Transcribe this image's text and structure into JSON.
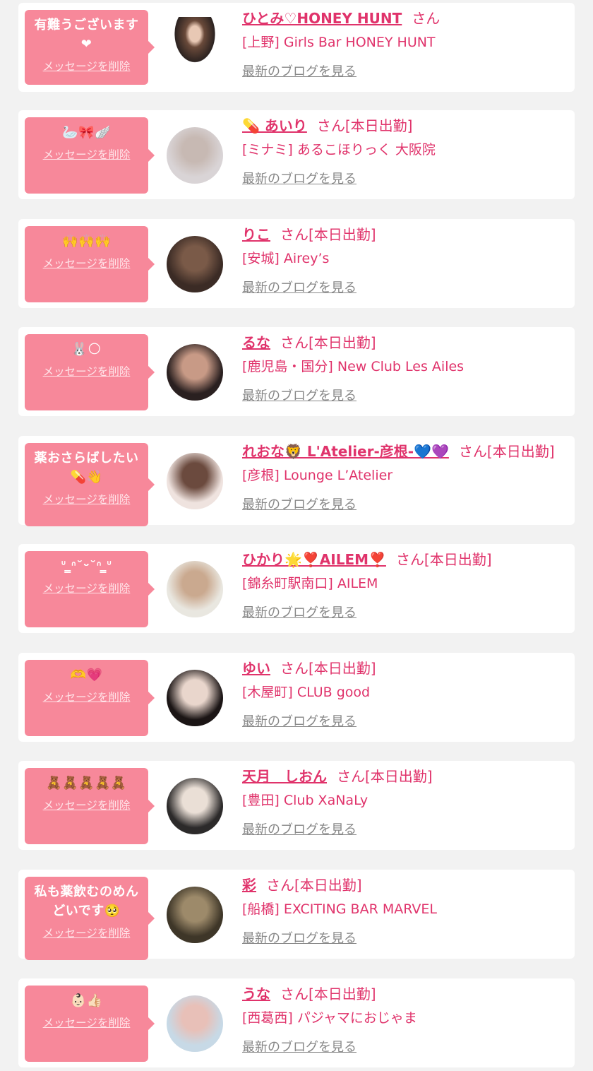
{
  "delete_label": "メッセージを削除",
  "blog_label": "最新のブログを見る",
  "colors": {
    "background": "#f2f2f2",
    "card": "#ffffff",
    "bubble": "#f7889a",
    "name": "#e0336b",
    "blog_link": "#888888"
  },
  "items": [
    {
      "message": "有難うございます❤",
      "name": "ひとみ♡HONEY HUNT",
      "suffix": "さん",
      "shop": "[上野] Girls Bar HONEY HUNT",
      "avatar": "avatar-photo"
    },
    {
      "message": "🦢🎀🪽",
      "name": "💊 あいり",
      "suffix": "さん[本日出勤]",
      "shop": "[ミナミ] あるこほりっく 大阪院",
      "avatar": "avatar-photo"
    },
    {
      "message": "🙌🙌🙌",
      "name": "りこ",
      "suffix": "さん[本日出勤]",
      "shop": "[安城] Airey’s",
      "avatar": "avatar-photo"
    },
    {
      "message": "🐰🌕",
      "name": "るな",
      "suffix": "さん[本日出勤]",
      "shop": "[鹿児島・国分] New Club Les Ailes",
      "avatar": "avatar-photo"
    },
    {
      "message": "薬おさらばしたい💊👋",
      "name": "れおな🦁 L'Atelier-彦根-💙💜",
      "suffix": "さん[本日出勤]",
      "shop": "[彦根] Lounge L’Atelier",
      "avatar": "avatar-photo"
    },
    {
      "message": "ᐡ ̳ᐢ˘ᵕ˘ᐢ ̳ᐡ",
      "name": "ひかり🌟❣️AILEM❣️",
      "suffix": "さん[本日出勤]",
      "shop": "[錦糸町駅南口] AILEM",
      "avatar": "avatar-photo"
    },
    {
      "message": "🫶💗",
      "name": "ゆい",
      "suffix": "さん[本日出勤]",
      "shop": "[木屋町] CLUB good",
      "avatar": "avatar-photo"
    },
    {
      "message": "🧸🧸🧸🧸🧸",
      "name": "天月　しおん",
      "suffix": "さん[本日出勤]",
      "shop": "[豊田] Club XaNaLy",
      "avatar": "avatar-photo"
    },
    {
      "message": "私も薬飲むのめんどいです🥺",
      "name": "彩",
      "suffix": "さん[本日出勤]",
      "shop": "[船橋] EXCITING BAR MARVEL",
      "avatar": "avatar-photo"
    },
    {
      "message": "👶🏻👍🏻",
      "name": "うな",
      "suffix": "さん[本日出勤]",
      "shop": "[西葛西] パジャマにおじゃま",
      "avatar": "avatar-photo"
    }
  ]
}
